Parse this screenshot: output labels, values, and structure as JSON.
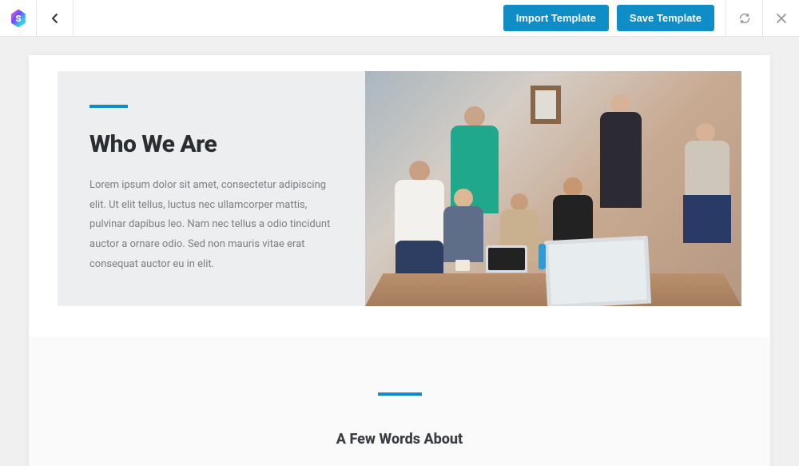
{
  "toolbar": {
    "import_label": "Import Template",
    "save_label": "Save Template"
  },
  "section1": {
    "title": "Who We Are",
    "body": "Lorem ipsum dolor sit amet, consectetur adipiscing elit. Ut elit tellus, luctus nec ullamcorper mattis, pulvinar dapibus leo. Nam nec tellus a odio tincidunt auctor a ornare odio. Sed non mauris vitae erat consequat auctor eu in elit."
  },
  "section2": {
    "subtitle": "A Few Words About"
  },
  "colors": {
    "accent": "#0f8dc7"
  }
}
